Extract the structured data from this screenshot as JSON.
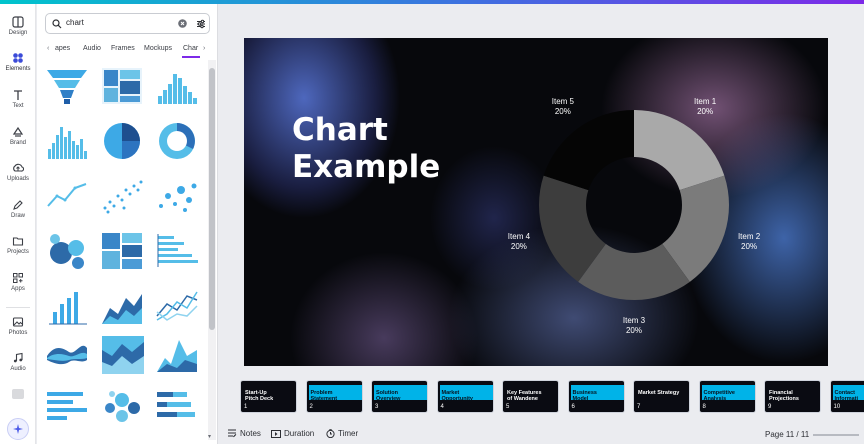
{
  "rail": {
    "items": [
      {
        "label": "Design",
        "icon": "design-icon"
      },
      {
        "label": "Elements",
        "icon": "elements-icon"
      },
      {
        "label": "Text",
        "icon": "text-icon"
      },
      {
        "label": "Brand",
        "icon": "brand-icon"
      },
      {
        "label": "Uploads",
        "icon": "uploads-icon"
      },
      {
        "label": "Draw",
        "icon": "draw-icon"
      },
      {
        "label": "Projects",
        "icon": "projects-icon"
      },
      {
        "label": "Apps",
        "icon": "apps-icon"
      },
      {
        "label": "Photos",
        "icon": "photos-icon"
      },
      {
        "label": "Audio",
        "icon": "audio-icon"
      }
    ]
  },
  "search": {
    "value": "chart"
  },
  "tabs": [
    "apes",
    "Audio",
    "Frames",
    "Mockups",
    "Char"
  ],
  "slide": {
    "title_line1": "Chart",
    "title_line2": "Example"
  },
  "chart_data": {
    "type": "pie",
    "labels": [
      "Item 1",
      "Item 2",
      "Item 3",
      "Item 4",
      "Item 5"
    ],
    "values": [
      20,
      20,
      20,
      20,
      20
    ],
    "value_labels": [
      "20%",
      "20%",
      "20%",
      "20%",
      "20%"
    ],
    "colors": [
      "#a9a9a9",
      "#7b7b7b",
      "#5c5c5c",
      "#3d3d3d",
      "#050505"
    ],
    "hole": true
  },
  "pages": [
    {
      "num": "1",
      "title": "Start-Up\nPitch Deck"
    },
    {
      "num": "2",
      "title": "Problem\nStatement"
    },
    {
      "num": "3",
      "title": "Solution\nOverview"
    },
    {
      "num": "4",
      "title": "Market\nOpportunity"
    },
    {
      "num": "5",
      "title": "Key Features\nof Wandene"
    },
    {
      "num": "6",
      "title": "Business\nModel"
    },
    {
      "num": "7",
      "title": "Market Strategy"
    },
    {
      "num": "8",
      "title": "Competitive\nAnalysis"
    },
    {
      "num": "9",
      "title": "Financial\nProjections"
    },
    {
      "num": "10",
      "title": "Contact\nInformati"
    }
  ],
  "bottom": {
    "notes": "Notes",
    "duration": "Duration",
    "timer": "Timer",
    "page": "Page 11 / 11"
  },
  "colors": {
    "accent": "#00b3e8",
    "brand": "#7d2ae8"
  }
}
